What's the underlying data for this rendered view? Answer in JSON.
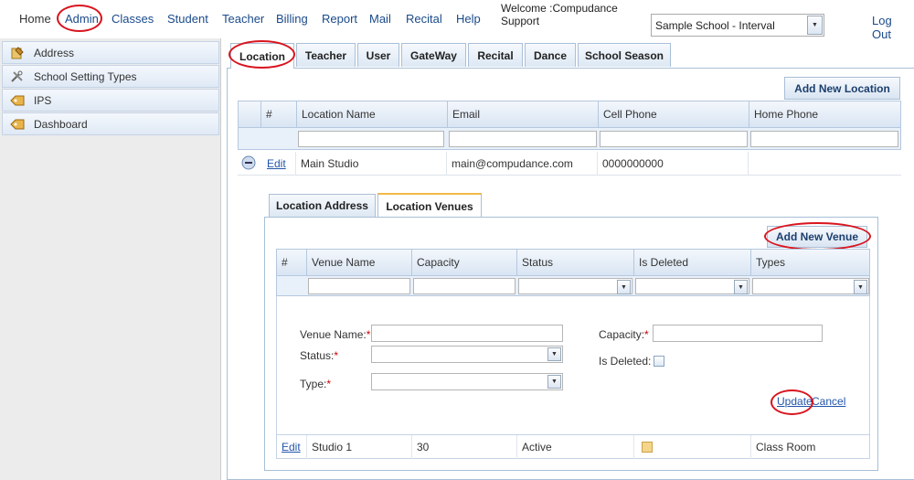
{
  "topnav": {
    "items": [
      "Home",
      "Admin",
      "Classes",
      "Student",
      "Teacher",
      "Billing",
      "Report",
      "Mail",
      "Recital",
      "Help"
    ],
    "welcome": "Welcome :Compudance Support",
    "school_select": "Sample School - Interval",
    "logout": "Log Out"
  },
  "sidebar": {
    "items": [
      {
        "label": "Address",
        "icon": "address-icon"
      },
      {
        "label": "School Setting Types",
        "icon": "tools-icon"
      },
      {
        "label": "IPS",
        "icon": "tag-icon"
      },
      {
        "label": "Dashboard",
        "icon": "tag-icon"
      }
    ]
  },
  "tabs": [
    "Location",
    "Teacher",
    "User",
    "GateWay",
    "Recital",
    "Dance",
    "School Season"
  ],
  "location_grid": {
    "add_button": "Add New Location",
    "headers": [
      "#",
      "Location Name",
      "Email",
      "Cell Phone",
      "Home Phone"
    ],
    "row": {
      "edit": "Edit",
      "name": "Main Studio",
      "email": "main@compudance.com",
      "cell": "0000000000",
      "home": ""
    }
  },
  "sub_tabs": [
    "Location Address",
    "Location Venues"
  ],
  "venues_grid": {
    "add_button": "Add New Venue",
    "headers": [
      "#",
      "Venue Name",
      "Capacity",
      "Status",
      "Is Deleted",
      "Types"
    ],
    "form": {
      "venue_name_label": "Venue Name:",
      "capacity_label": "Capacity:",
      "status_label": "Status:",
      "is_deleted_label": "Is Deleted:",
      "type_label": "Type:",
      "required_mark": "*",
      "update": "Update",
      "cancel": "Cancel"
    },
    "row": {
      "edit": "Edit",
      "name": "Studio 1",
      "capacity": "30",
      "status": "Active",
      "types": "Class Room"
    }
  },
  "colors": {
    "accent_circle": "#d9141e",
    "link": "#1a4a8a",
    "header_bg": "#d9e5f3"
  }
}
